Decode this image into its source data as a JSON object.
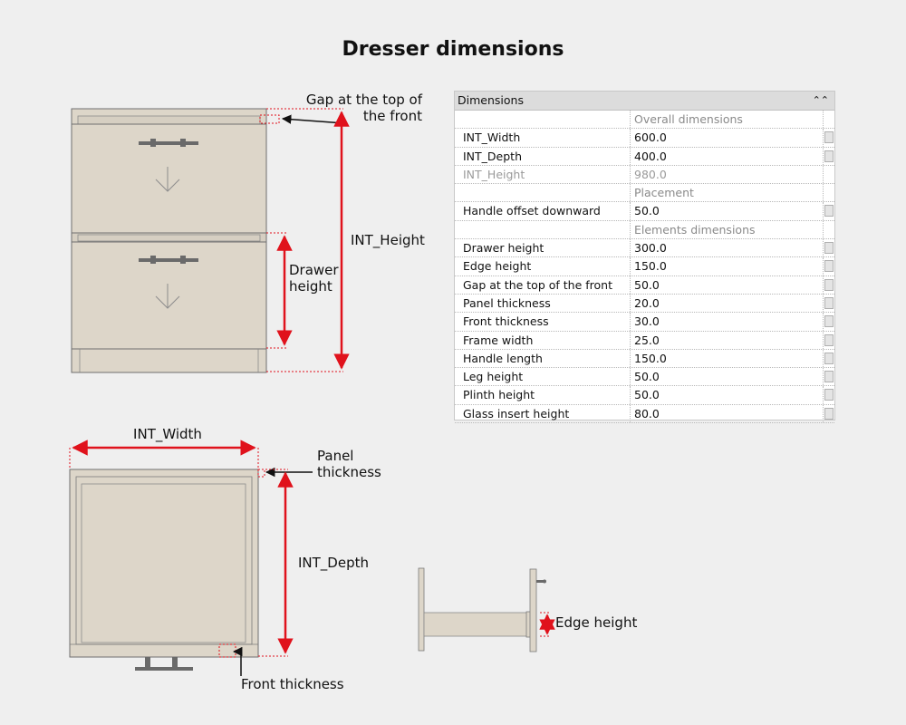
{
  "title": "Dresser dimensions",
  "labels": {
    "gap_top_line1": "Gap at the top of",
    "gap_top_line2": "the front",
    "int_height": "INT_Height",
    "drawer_height_line1": "Drawer",
    "drawer_height_line2": "height",
    "int_width": "INT_Width",
    "panel_thickness_line1": "Panel",
    "panel_thickness_line2": "thickness",
    "int_depth": "INT_Depth",
    "front_thickness": "Front thickness",
    "edge_height": "Edge height"
  },
  "colors": {
    "dimension_red": "#e0121c",
    "furniture_fill": "#ddd6c9",
    "handle_gray": "#6a6a6a",
    "background": "#efefef"
  },
  "panel": {
    "header": "Dimensions",
    "collapse_icon": "double-chevron-up-icon",
    "rows": [
      {
        "kind": "group",
        "value": "Overall dimensions"
      },
      {
        "kind": "param",
        "name": "INT_Width",
        "value": "600.0"
      },
      {
        "kind": "param",
        "name": "INT_Depth",
        "value": "400.0"
      },
      {
        "kind": "readonly",
        "name": "INT_Height",
        "value": "980.0"
      },
      {
        "kind": "group",
        "value": "Placement"
      },
      {
        "kind": "param",
        "name": "Handle offset downward",
        "value": "50.0"
      },
      {
        "kind": "group",
        "value": "Elements dimensions"
      },
      {
        "kind": "param",
        "name": "Drawer height",
        "value": "300.0"
      },
      {
        "kind": "param",
        "name": "Edge height",
        "value": "150.0"
      },
      {
        "kind": "param",
        "name": "Gap at the top of the front",
        "value": "50.0"
      },
      {
        "kind": "param",
        "name": "Panel thickness",
        "value": "20.0"
      },
      {
        "kind": "param",
        "name": "Front thickness",
        "value": "30.0"
      },
      {
        "kind": "param",
        "name": "Frame width",
        "value": "25.0"
      },
      {
        "kind": "param",
        "name": "Handle length",
        "value": "150.0"
      },
      {
        "kind": "param",
        "name": "Leg height",
        "value": "50.0"
      },
      {
        "kind": "param",
        "name": "Plinth height",
        "value": "50.0"
      },
      {
        "kind": "param",
        "name": "Glass insert height",
        "value": "80.0"
      }
    ]
  }
}
